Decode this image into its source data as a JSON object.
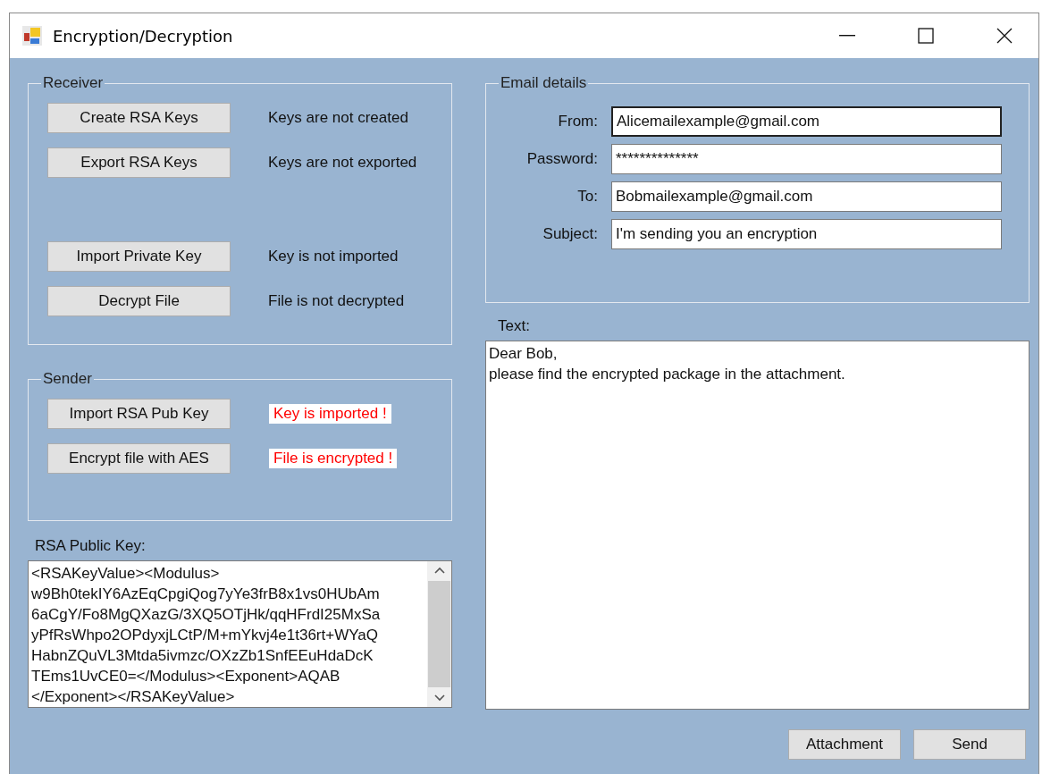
{
  "window": {
    "title": "Encryption/Decryption"
  },
  "receiver": {
    "title": "Receiver",
    "rows": [
      {
        "button": "Create RSA Keys",
        "status": "Keys are not created",
        "kind": "notice"
      },
      {
        "button": "Export RSA Keys",
        "status": "Keys are not exported",
        "kind": "notice"
      },
      {
        "button": "Import Private Key",
        "status": "Key is not imported",
        "kind": "notice"
      },
      {
        "button": "Decrypt File",
        "status": "File is not decrypted",
        "kind": "notice"
      }
    ]
  },
  "sender": {
    "title": "Sender",
    "rows": [
      {
        "button": "Import RSA Pub Key",
        "status": "Key is imported !",
        "kind": "alert"
      },
      {
        "button": "Encrypt file with AES",
        "status": "File is encrypted !",
        "kind": "alert"
      }
    ]
  },
  "public_key": {
    "label": "RSA Public Key:",
    "lines": [
      "<RSAKeyValue><Modulus>",
      "w9Bh0tekIY6AzEqCpgiQog7yYe3frB8x1vs0HUbAm",
      "6aCgY/Fo8MgQXazG/3XQ5OTjHk/qqHFrdI25MxSa",
      "yPfRsWhpo2OPdyxjLCtP/M+mYkvj4e1t36rt+WYaQ",
      "HabnZQuVL3Mtda5ivmzc/OXzZb1SnfEEuHdaDcK",
      "TEms1UvCE0=</Modulus><Exponent>AQAB",
      "</Exponent></RSAKeyValue>"
    ]
  },
  "email": {
    "title": "Email details",
    "fields": [
      {
        "label": "From:",
        "value": "Alicemailexample@gmail.com",
        "focused": true
      },
      {
        "label": "Password:",
        "value": "**************",
        "focused": false
      },
      {
        "label": "To:",
        "value": "Bobmailexample@gmail.com",
        "focused": false
      },
      {
        "label": "Subject:",
        "value": "I'm sending you an encryption",
        "focused": false
      }
    ]
  },
  "text": {
    "label": "Text:",
    "lines": [
      "Dear Bob,",
      "please find the encrypted package in the attachment."
    ]
  },
  "buttons": [
    "Attachment",
    "Send"
  ]
}
